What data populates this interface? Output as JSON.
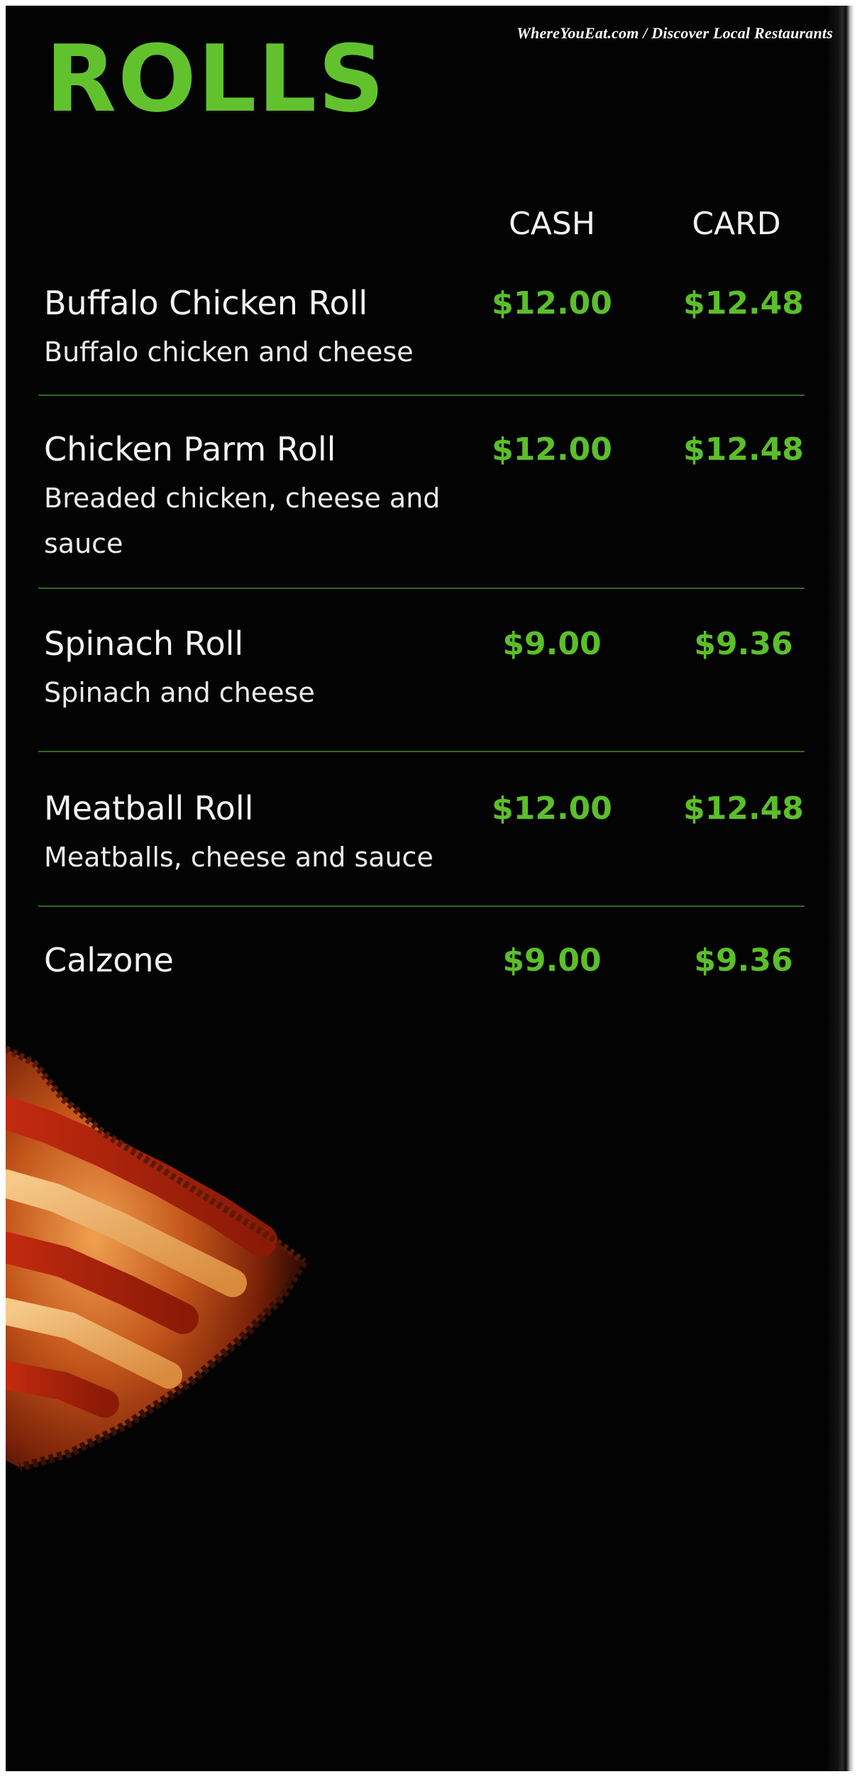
{
  "watermark": "WhereYouEat.com / Discover Local Restaurants",
  "title": "ROLLS",
  "columns": {
    "cash": "CASH",
    "card": "CARD"
  },
  "items": [
    {
      "name": "Buffalo Chicken Roll",
      "description": "Buffalo chicken and cheese",
      "cash": "$12.00",
      "card": "$12.48"
    },
    {
      "name": "Chicken Parm Roll",
      "description": "Breaded chicken, cheese and sauce",
      "cash": "$12.00",
      "card": "$12.48"
    },
    {
      "name": "Spinach Roll",
      "description": "Spinach and cheese",
      "cash": "$9.00",
      "card": "$9.36"
    },
    {
      "name": "Meatball Roll",
      "description": "Meatballs, cheese and sauce",
      "cash": "$12.00",
      "card": "$12.48"
    },
    {
      "name": "Calzone",
      "description": "",
      "cash": "$9.00",
      "card": "$9.36"
    }
  ],
  "colors": {
    "accent": "#62c22e",
    "background": "#030303",
    "text": "#f3f3f3"
  }
}
